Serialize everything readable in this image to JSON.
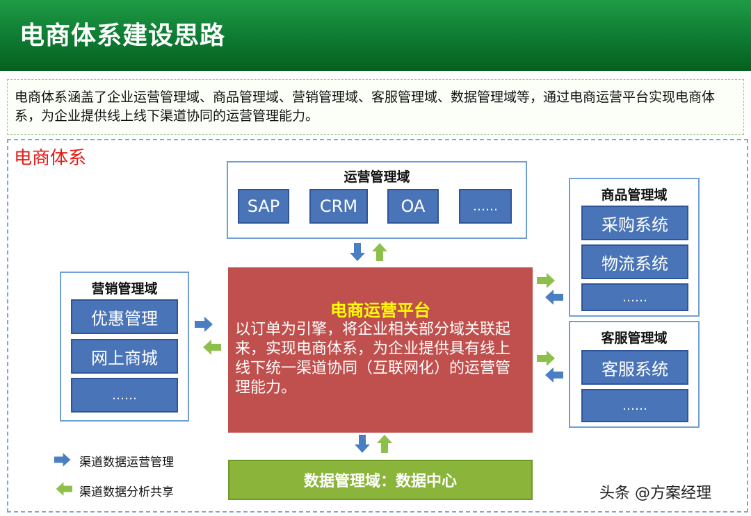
{
  "header": {
    "title": "电商体系建设思路"
  },
  "intro": {
    "text": "电商体系涵盖了企业运营管理域、商品管理域、营销管理域、客服管理域、数据管理域等，通过电商运营平台实现电商体系，为企业提供线上线下渠道协同的运营管理能力。"
  },
  "system": {
    "title": "电商体系"
  },
  "operations": {
    "title": "运营管理域",
    "items": [
      "SAP",
      "CRM",
      "OA",
      "……"
    ]
  },
  "marketing": {
    "title": "营销管理域",
    "items": [
      "优惠管理",
      "网上商城",
      "……"
    ]
  },
  "goods": {
    "title": "商品管理域",
    "items": [
      "采购系统",
      "物流系统",
      "……"
    ]
  },
  "service": {
    "title": "客服管理域",
    "items": [
      "客服系统",
      "……"
    ]
  },
  "platform": {
    "title": "电商运营平台",
    "desc": "以订单为引擎，将企业相关部分域关联起来，实现电商体系，为企业提供具有线上线下统一渠道协同（互联网化）的运营管理能力。"
  },
  "data_domain": {
    "label": "数据管理域：数据中心"
  },
  "legend": {
    "blue": "渠道数据运营管理",
    "green": "渠道数据分析共享"
  },
  "colors": {
    "blue_arrow": "#4a7ec2",
    "green_arrow": "#8cc04a",
    "platform": "#c0504d",
    "header": "#0d7a31",
    "system_title": "#e41b17"
  },
  "watermark": "头条 @方案经理"
}
